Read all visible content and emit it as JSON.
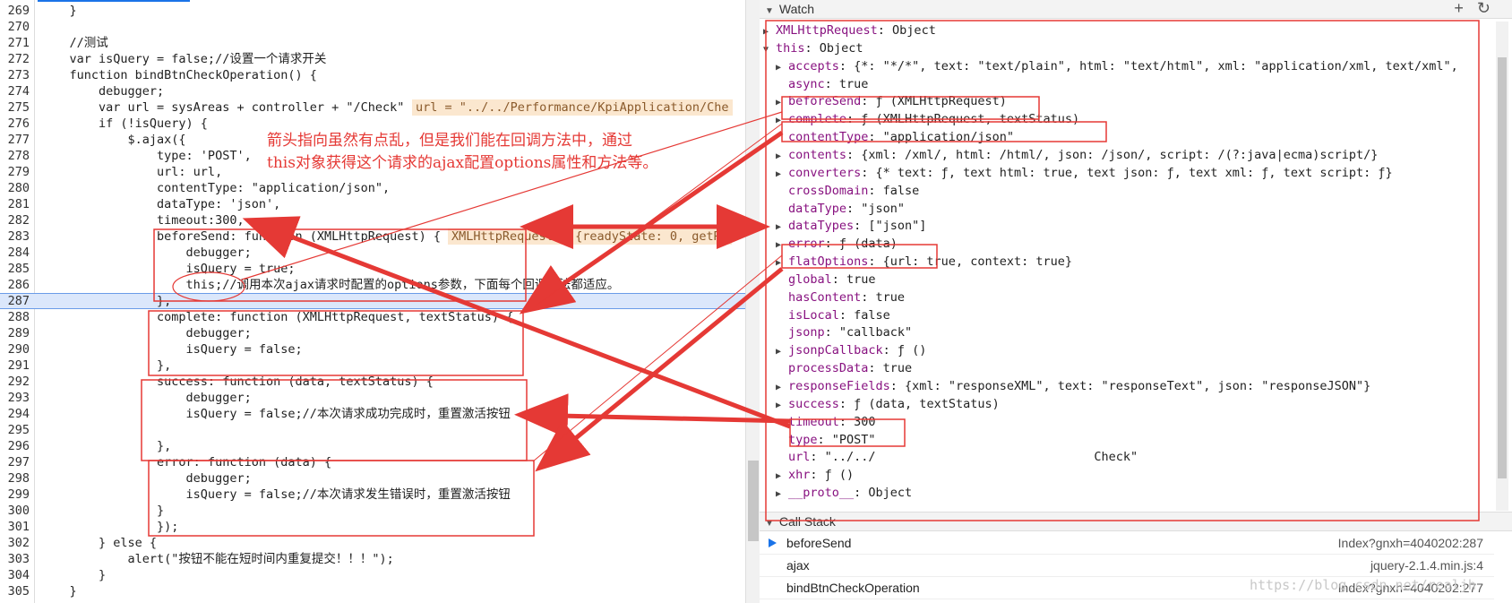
{
  "code": {
    "lines": [
      {
        "n": "269",
        "t": "    }"
      },
      {
        "n": "270",
        "t": ""
      },
      {
        "n": "271",
        "t": "    //测试"
      },
      {
        "n": "272",
        "t": "    var isQuery = false;//设置一个请求开关"
      },
      {
        "n": "273",
        "t": "    function bindBtnCheckOperation() {"
      },
      {
        "n": "274",
        "t": "        debugger;"
      },
      {
        "n": "275",
        "t": "        var url = sysAreas + controller + \"/Check\""
      },
      {
        "n": "276",
        "t": "        if (!isQuery) {"
      },
      {
        "n": "277",
        "t": "            $.ajax({"
      },
      {
        "n": "278",
        "t": "                type: 'POST',"
      },
      {
        "n": "279",
        "t": "                url: url,"
      },
      {
        "n": "280",
        "t": "                contentType: \"application/json\","
      },
      {
        "n": "281",
        "t": "                dataType: 'json',"
      },
      {
        "n": "282",
        "t": "                timeout:300,"
      },
      {
        "n": "283",
        "t": "                beforeSend: function (XMLHttpRequest) {"
      },
      {
        "n": "284",
        "t": "                    debugger;"
      },
      {
        "n": "285",
        "t": "                    isQuery = true;"
      },
      {
        "n": "286",
        "t": "                    this;//调用本次ajax请求时配置的options参数，下面每个回调方法都适应。"
      },
      {
        "n": "287",
        "t": "                },"
      },
      {
        "n": "288",
        "t": "                complete: function (XMLHttpRequest, textStatus) {"
      },
      {
        "n": "289",
        "t": "                    debugger;"
      },
      {
        "n": "290",
        "t": "                    isQuery = false;"
      },
      {
        "n": "291",
        "t": "                },"
      },
      {
        "n": "292",
        "t": "                success: function (data, textStatus) {"
      },
      {
        "n": "293",
        "t": "                    debugger;"
      },
      {
        "n": "294",
        "t": "                    isQuery = false;//本次请求成功完成时，重置激活按钮"
      },
      {
        "n": "295",
        "t": ""
      },
      {
        "n": "296",
        "t": "                },"
      },
      {
        "n": "297",
        "t": "                error: function (data) {"
      },
      {
        "n": "298",
        "t": "                    debugger;"
      },
      {
        "n": "299",
        "t": "                    isQuery = false;//本次请求发生错误时，重置激活按钮"
      },
      {
        "n": "300",
        "t": "                }"
      },
      {
        "n": "301",
        "t": "                });"
      },
      {
        "n": "302",
        "t": "        } else {"
      },
      {
        "n": "303",
        "t": "            alert(\"按钮不能在短时间内重复提交！！！\");"
      },
      {
        "n": "304",
        "t": "        }"
      },
      {
        "n": "305",
        "t": "    }"
      }
    ],
    "inline_url": "url = \"../../Performance/KpiApplication/Che",
    "inline_xhr": "XMLHttpRequest = {readyState: 0, getRe",
    "annotation": "箭头指向虽然有点乱，但是我们能在回调方法中，通过\nthis对象获得这个请求的ajax配置options属性和方法等。"
  },
  "watch": {
    "title": "Watch",
    "add_icon": "+",
    "refresh_icon": "↻",
    "items": [
      {
        "arrow": "▶",
        "k": "XMLHttpRequest",
        "v": ": Object",
        "indent": 0
      },
      {
        "arrow": "▼",
        "k": "this",
        "v": ": Object",
        "indent": 0
      },
      {
        "arrow": "▶",
        "k": "accepts",
        "v": ": {*: \"*/*\", text: \"text/plain\", html: \"text/html\", xml: \"application/xml, text/xml\",",
        "indent": 1
      },
      {
        "arrow": "",
        "k": "async",
        "v": ": true",
        "indent": 1
      },
      {
        "arrow": "▶",
        "k": "beforeSend",
        "v": ": ƒ (XMLHttpRequest)",
        "indent": 1
      },
      {
        "arrow": "▶",
        "k": "complete",
        "v": ": ƒ (XMLHttpRequest, textStatus)",
        "indent": 1
      },
      {
        "arrow": "",
        "k": "contentType",
        "v": ": \"application/json\"",
        "indent": 1
      },
      {
        "arrow": "▶",
        "k": "contents",
        "v": ": {xml: /xml/, html: /html/, json: /json/, script: /(?:java|ecma)script/}",
        "indent": 1
      },
      {
        "arrow": "▶",
        "k": "converters",
        "v": ": {* text: ƒ, text html: true, text json: ƒ, text xml: ƒ, text script: ƒ}",
        "indent": 1
      },
      {
        "arrow": "",
        "k": "crossDomain",
        "v": ": false",
        "indent": 1
      },
      {
        "arrow": "",
        "k": "dataType",
        "v": ": \"json\"",
        "indent": 1
      },
      {
        "arrow": "▶",
        "k": "dataTypes",
        "v": ": [\"json\"]",
        "indent": 1
      },
      {
        "arrow": "▶",
        "k": "error",
        "v": ": ƒ (data)",
        "indent": 1
      },
      {
        "arrow": "▶",
        "k": "flatOptions",
        "v": ": {url: true, context: true}",
        "indent": 1
      },
      {
        "arrow": "",
        "k": "global",
        "v": ": true",
        "indent": 1
      },
      {
        "arrow": "",
        "k": "hasContent",
        "v": ": true",
        "indent": 1
      },
      {
        "arrow": "",
        "k": "isLocal",
        "v": ": false",
        "indent": 1
      },
      {
        "arrow": "",
        "k": "jsonp",
        "v": ": \"callback\"",
        "indent": 1
      },
      {
        "arrow": "▶",
        "k": "jsonpCallback",
        "v": ": ƒ ()",
        "indent": 1
      },
      {
        "arrow": "",
        "k": "processData",
        "v": ": true",
        "indent": 1
      },
      {
        "arrow": "▶",
        "k": "responseFields",
        "v": ": {xml: \"responseXML\", text: \"responseText\", json: \"responseJSON\"}",
        "indent": 1
      },
      {
        "arrow": "▶",
        "k": "success",
        "v": ": ƒ (data, textStatus)",
        "indent": 1
      },
      {
        "arrow": "",
        "k": "timeout",
        "v": ": 300",
        "indent": 1
      },
      {
        "arrow": "",
        "k": "type",
        "v": ": \"POST\"",
        "indent": 1
      },
      {
        "arrow": "",
        "k": "url",
        "v": ": \"../../                              Check\"",
        "indent": 1
      },
      {
        "arrow": "▶",
        "k": "xhr",
        "v": ": ƒ ()",
        "indent": 1
      },
      {
        "arrow": "▶",
        "k": "__proto__",
        "v": ": Object",
        "indent": 1
      }
    ]
  },
  "callstack": {
    "title": "Call Stack",
    "frames": [
      {
        "fn": "beforeSend",
        "loc": "Index?gnxh=4040202:287"
      },
      {
        "fn": "ajax",
        "loc": "jquery-2.1.4.min.js:4"
      },
      {
        "fn": "bindBtnCheckOperation",
        "loc": "Index?gnxh=4040202:277"
      }
    ]
  },
  "watermark": "https://blog.csdn.net/realjh"
}
